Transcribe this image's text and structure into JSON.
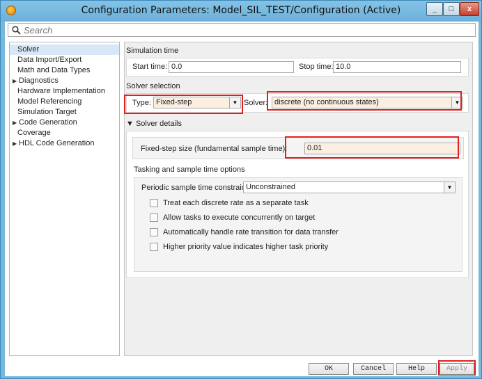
{
  "window": {
    "title": "Configuration Parameters: Model_SIL_TEST/Configuration (Active)",
    "controls": {
      "minimize": "_",
      "maximize": "□",
      "close": "x"
    }
  },
  "search": {
    "placeholder": "Search"
  },
  "tree": {
    "items": [
      {
        "label": "Solver",
        "selected": true,
        "expandable": false,
        "indent": 1
      },
      {
        "label": "Data Import/Export",
        "expandable": false,
        "indent": 1
      },
      {
        "label": "Math and Data Types",
        "expandable": false,
        "indent": 1
      },
      {
        "label": "Diagnostics",
        "expandable": true,
        "indent": 0
      },
      {
        "label": "Hardware Implementation",
        "expandable": false,
        "indent": 1
      },
      {
        "label": "Model Referencing",
        "expandable": false,
        "indent": 1
      },
      {
        "label": "Simulation Target",
        "expandable": false,
        "indent": 1
      },
      {
        "label": "Code Generation",
        "expandable": true,
        "indent": 0
      },
      {
        "label": "Coverage",
        "expandable": false,
        "indent": 1
      },
      {
        "label": "HDL Code Generation",
        "expandable": true,
        "indent": 0
      }
    ]
  },
  "simulation_time": {
    "heading": "Simulation time",
    "start_label": "Start time:",
    "start_value": "0.0",
    "stop_label": "Stop time:",
    "stop_value": "10.0"
  },
  "solver_selection": {
    "heading": "Solver selection",
    "type_label": "Type:",
    "type_value": "Fixed-step",
    "solver_label": "Solver:",
    "solver_value": "discrete (no continuous states)"
  },
  "solver_details": {
    "heading": "▼ Solver details",
    "fixed_step_label": "Fixed-step size (fundamental sample time):",
    "fixed_step_value": "0.01",
    "tasking_heading": "Tasking and sample time options",
    "periodic_label": "Periodic sample time constraint:",
    "periodic_value": "Unconstrained",
    "checkboxes": [
      {
        "label": "Treat each discrete rate as a separate task",
        "checked": false
      },
      {
        "label": "Allow tasks to execute concurrently on target",
        "checked": false
      },
      {
        "label": "Automatically handle rate transition for data transfer",
        "checked": false
      },
      {
        "label": "Higher priority value indicates higher task priority",
        "checked": false
      }
    ]
  },
  "footer": {
    "ok": "OK",
    "cancel": "Cancel",
    "help": "Help",
    "apply": "Apply"
  },
  "colors": {
    "highlight": "#e02020",
    "selected_tree_item": "#d8e7f7",
    "combo_fill": "#fbefe2",
    "titlebar": "#77b9dc"
  }
}
